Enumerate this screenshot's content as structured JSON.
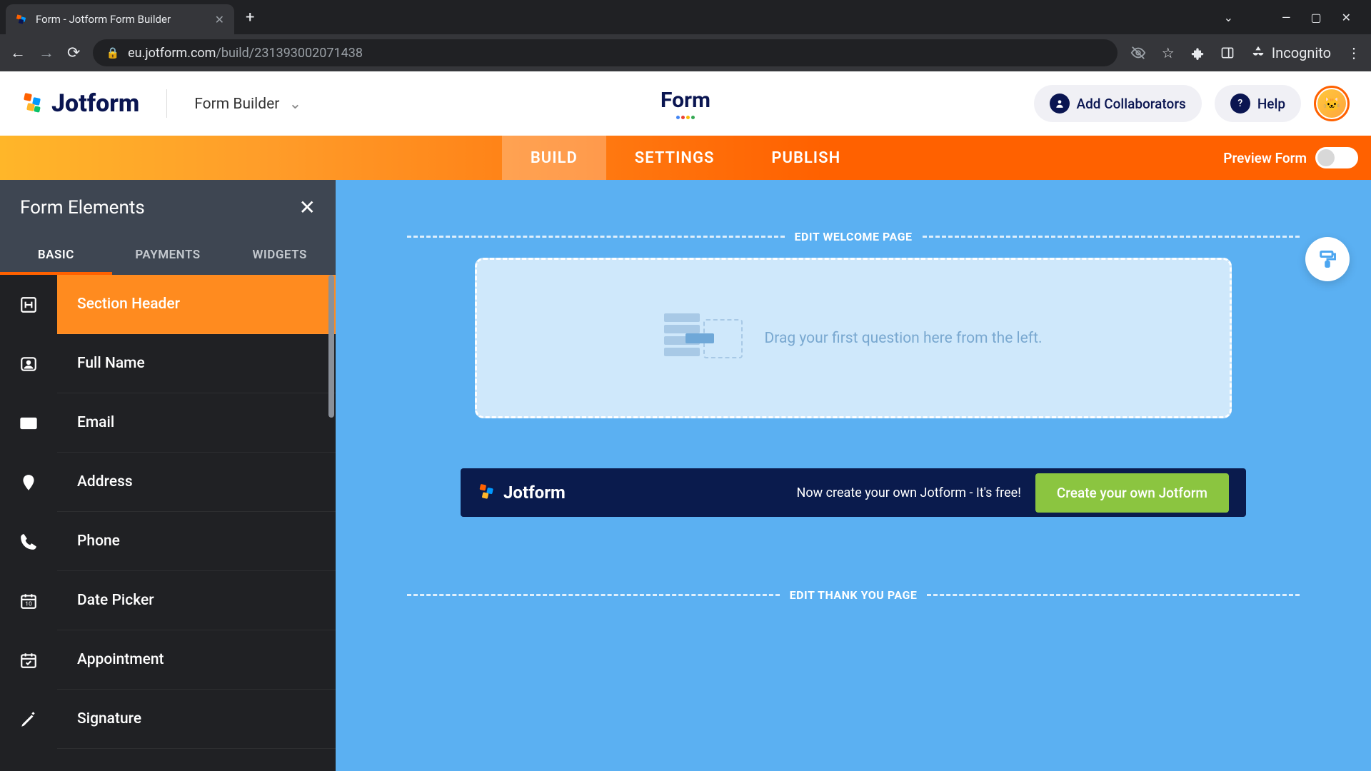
{
  "browser": {
    "tab_title": "Form - Jotform Form Builder",
    "url_domain": "eu.jotform.com",
    "url_path": "/build/231393002071438",
    "incognito_label": "Incognito"
  },
  "header": {
    "brand": "Jotform",
    "builder_label": "Form Builder",
    "form_title": "Form",
    "collab_label": "Add Collaborators",
    "help_label": "Help"
  },
  "main_tabs": {
    "build": "BUILD",
    "settings": "SETTINGS",
    "publish": "PUBLISH",
    "preview_label": "Preview Form"
  },
  "sidebar": {
    "title": "Form Elements",
    "tabs": {
      "basic": "BASIC",
      "payments": "PAYMENTS",
      "widgets": "WIDGETS"
    },
    "items": [
      {
        "label": "Section Header"
      },
      {
        "label": "Full Name"
      },
      {
        "label": "Email"
      },
      {
        "label": "Address"
      },
      {
        "label": "Phone"
      },
      {
        "label": "Date Picker"
      },
      {
        "label": "Appointment"
      },
      {
        "label": "Signature"
      }
    ]
  },
  "canvas": {
    "welcome_divider": "EDIT WELCOME PAGE",
    "drop_hint": "Drag your first question here from the left.",
    "thankyou_divider": "EDIT THANK YOU PAGE"
  },
  "promo": {
    "brand": "Jotform",
    "text": "Now create your own Jotform - It's free!",
    "cta": "Create your own Jotform"
  }
}
